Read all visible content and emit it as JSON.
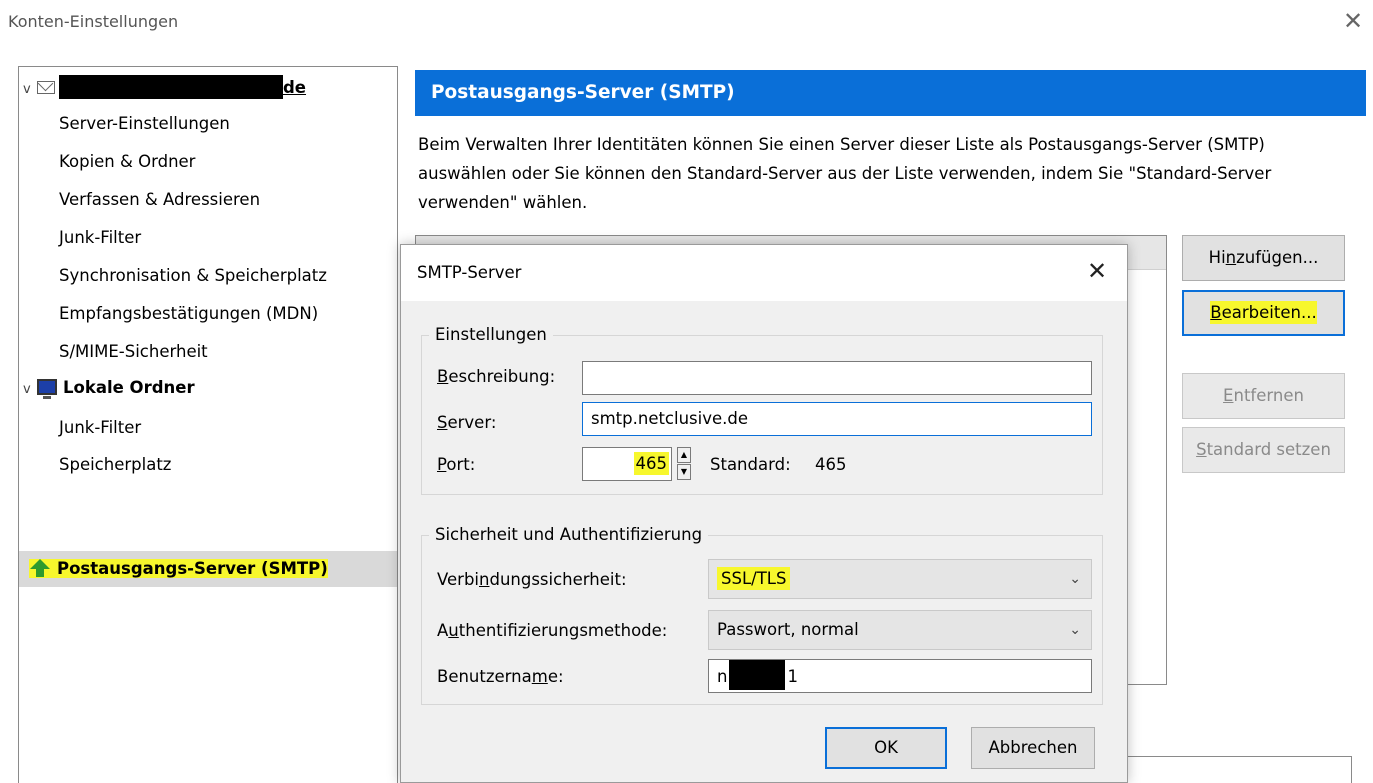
{
  "window": {
    "title": "Konten-Einstellungen",
    "close_glyph": "✕"
  },
  "tree": {
    "account": {
      "suffix": "de"
    },
    "account_items": [
      "Server-Einstellungen",
      "Kopien & Ordner",
      "Verfassen & Adressieren",
      "Junk-Filter",
      "Synchronisation & Speicherplatz",
      "Empfangsbestätigungen (MDN)",
      "S/MIME-Sicherheit"
    ],
    "local": {
      "label": "Lokale Ordner"
    },
    "local_items": [
      "Junk-Filter",
      "Speicherplatz"
    ],
    "smtp": {
      "label": "Postausgangs-Server (SMTP)"
    }
  },
  "panel": {
    "header": "Postausgangs-Server (SMTP)",
    "desc1": "Beim Verwalten Ihrer Identitäten können Sie einen Server dieser Liste als Postausgangs-Server (SMTP)",
    "desc2": "auswählen oder Sie können den Standard-Server aus der Liste verwenden, indem Sie \"Standard-Server",
    "desc3": "verwenden\" wählen.",
    "buttons": {
      "add_a": "Hi",
      "add_u": "n",
      "add_b": "zufügen...",
      "edit_u": "B",
      "edit_b": "earbeiten...",
      "remove_u": "E",
      "remove_b": "ntfernen",
      "default_u": "S",
      "default_b": "tandard setzen"
    }
  },
  "dialog": {
    "title": "SMTP-Server",
    "close_glyph": "✕",
    "settings_group": "Einstellungen",
    "description": {
      "label_u": "B",
      "label_b": "eschreibung:",
      "value": ""
    },
    "server": {
      "label_u": "S",
      "label_b": "erver:",
      "value": "smtp.netclusive.de"
    },
    "port": {
      "label_u": "P",
      "label_b": "ort:",
      "value": "465",
      "default_label": "Standard:",
      "default_value": "465"
    },
    "security_group": "Sicherheit und Authentifizierung",
    "connection_security": {
      "label_a": "Verbi",
      "label_u": "n",
      "label_b": "dungssicherheit:",
      "value": "SSL/TLS"
    },
    "auth_method": {
      "label_a": "A",
      "label_u": "u",
      "label_b": "thentifizierungsmethode:",
      "value": "Passwort, normal"
    },
    "username": {
      "label_a": "Benutzerna",
      "label_u": "m",
      "label_b": "e:",
      "value_start": "n",
      "value_end": "1"
    },
    "ok": "OK",
    "cancel": "Abbrechen"
  },
  "colors": {
    "accent": "#0a6fd8",
    "highlight": "#f7f72d",
    "selection": "#d9d9d9"
  },
  "icons": [
    "envelope-icon",
    "monitor-icon",
    "upload-arrow-icon",
    "chevron-down-icon",
    "close-icon"
  ]
}
